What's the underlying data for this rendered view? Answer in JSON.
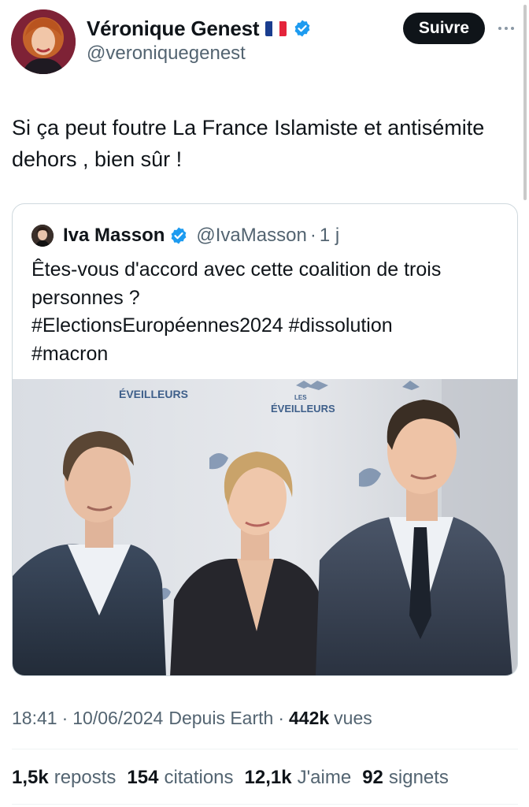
{
  "author": {
    "display_name": "Véronique Genest",
    "handle": "@veroniquegenest",
    "flag_icon": "france-flag-icon",
    "verified_icon": "verified-badge-icon",
    "verified_color": "#1d9bf0"
  },
  "follow_label": "Suivre",
  "more_icon": "more-horizontal-icon",
  "tweet": {
    "text": "Si ça peut foutre La France Islamiste et antisémite dehors , bien sûr !"
  },
  "quoted": {
    "display_name": "Iva Masson",
    "handle": "@IvaMasson",
    "separator": "·",
    "time": "1 j",
    "lines": [
      "Êtes-vous d'accord avec cette coalition de trois",
      "personnes ?",
      "#ElectionsEuropéennes2024 #dissolution",
      "#macron"
    ],
    "image": {
      "banner_text_1": "ÉVEILLEURS",
      "banner_text_2_small": "LES",
      "banner_text_2": "ÉVEILLEURS"
    }
  },
  "meta": {
    "time": "18:41",
    "date": "10/06/2024",
    "source": "Depuis Earth",
    "views_count": "442k",
    "views_label": "vues"
  },
  "stats": [
    {
      "count": "1,5k",
      "label": "reposts"
    },
    {
      "count": "154",
      "label": "citations"
    },
    {
      "count": "12,1k",
      "label": "J'aime"
    },
    {
      "count": "92",
      "label": "signets"
    }
  ]
}
